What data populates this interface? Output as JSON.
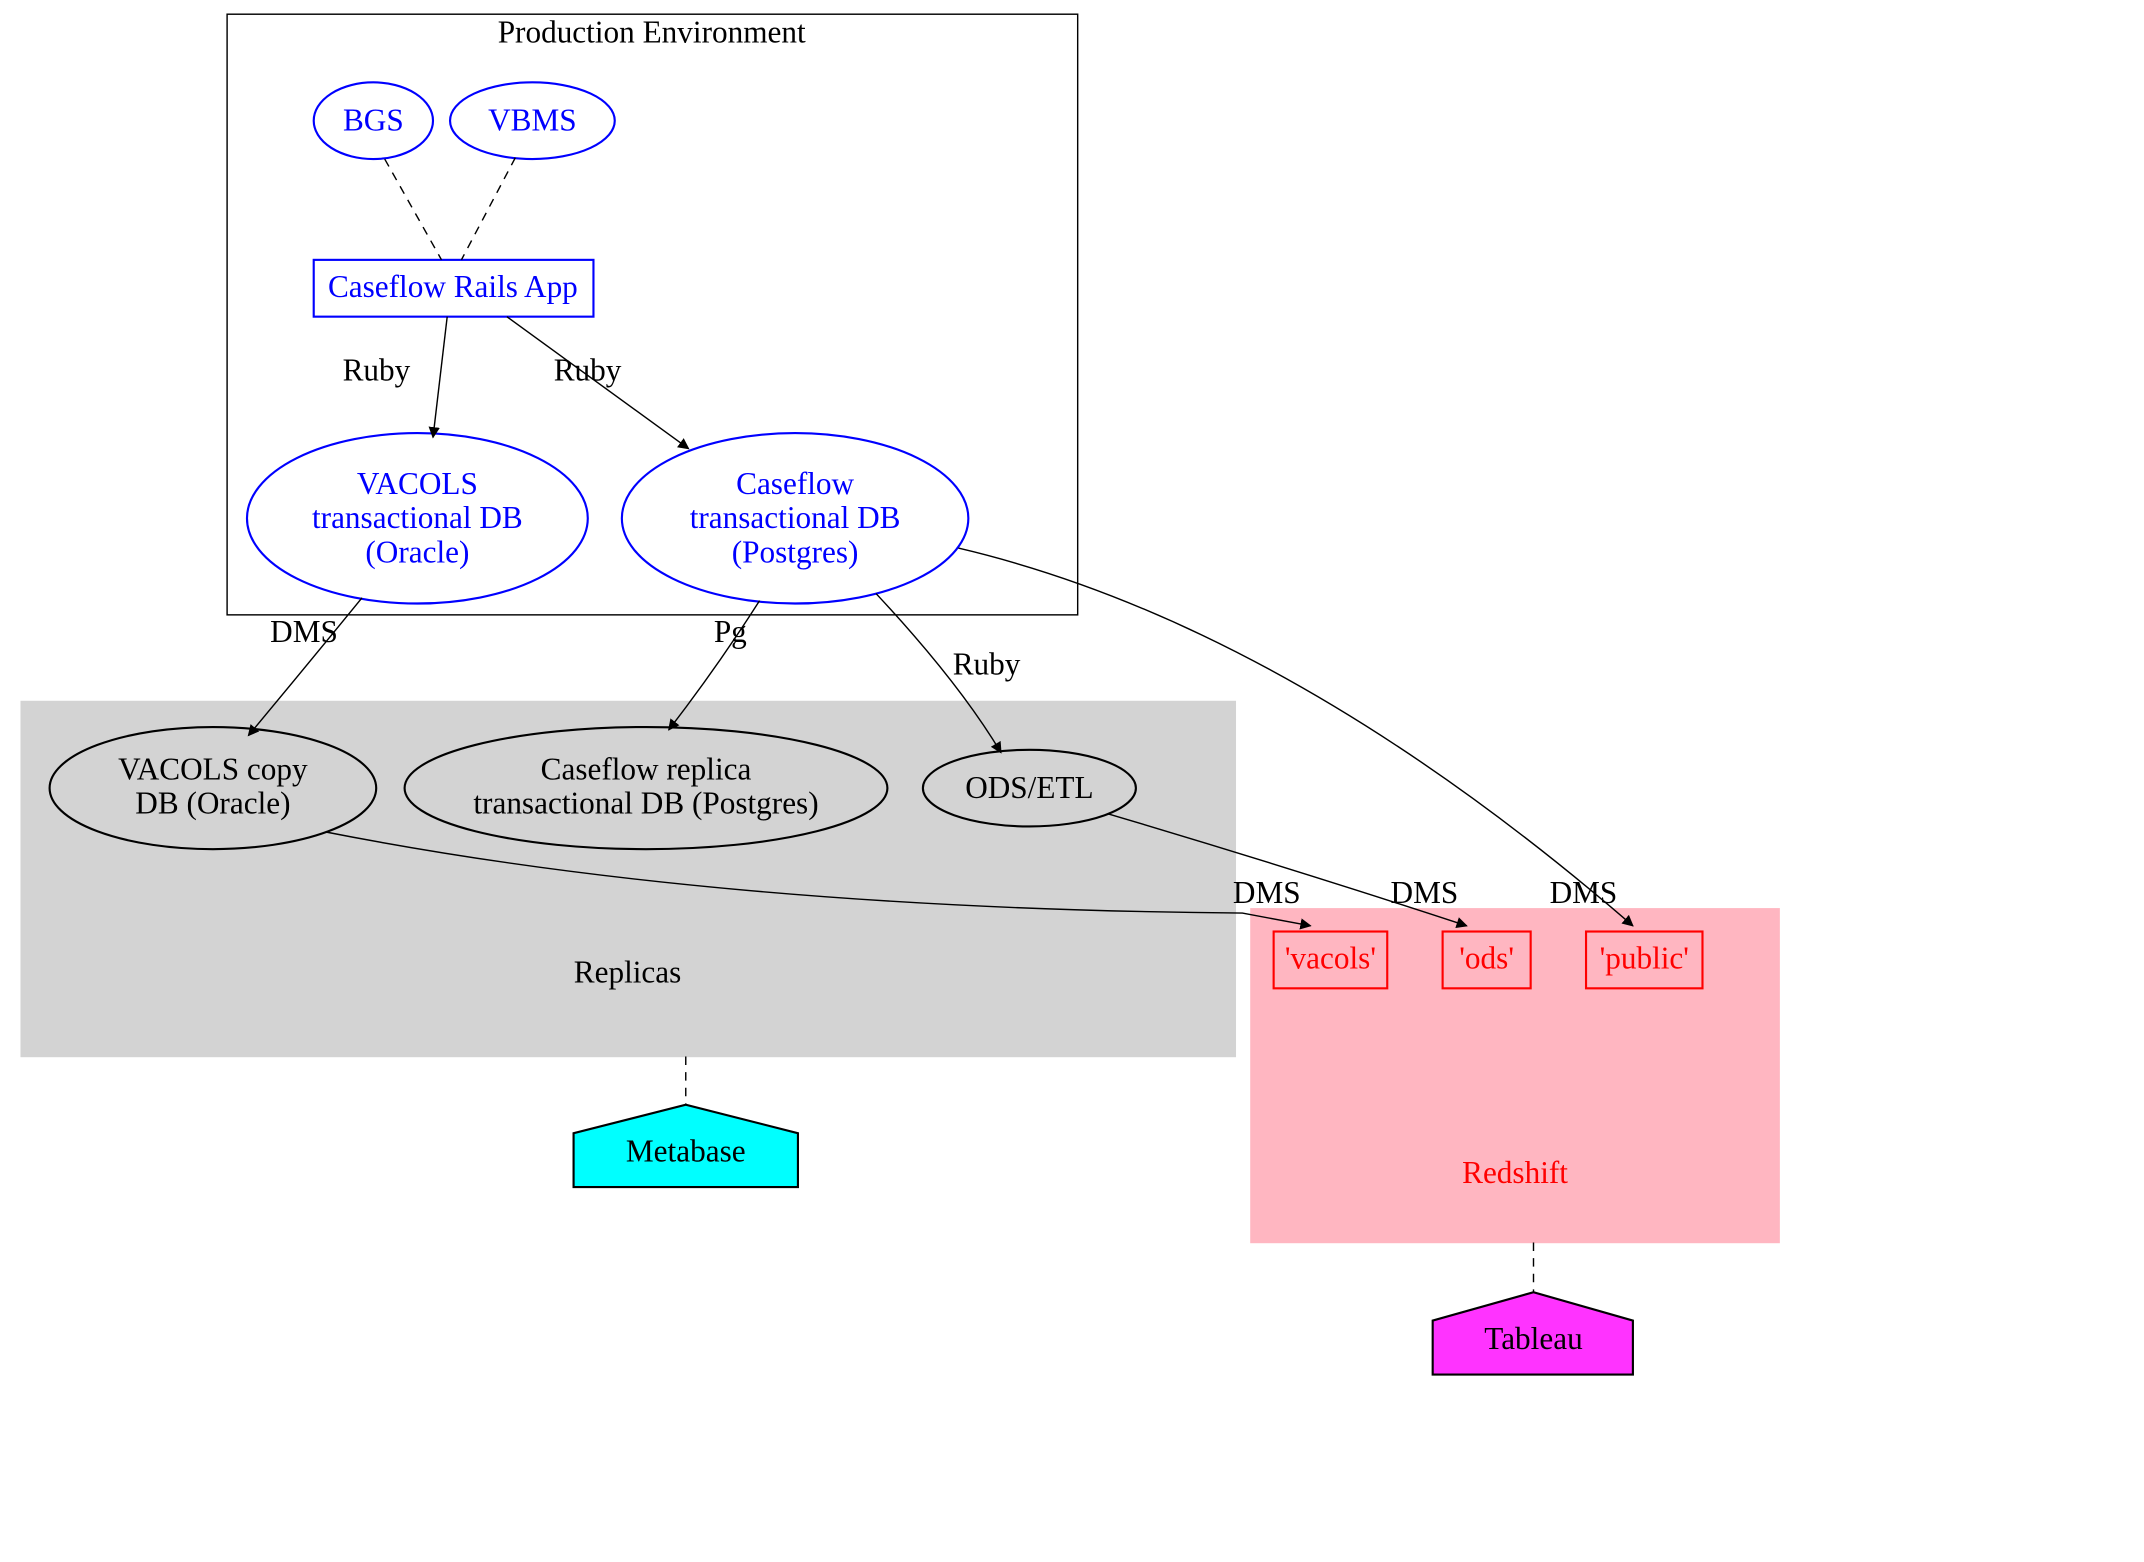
{
  "clusters": {
    "prod": {
      "title": "Production Environment"
    },
    "replicas": {
      "title": "Replicas"
    },
    "redshift": {
      "title": "Redshift"
    }
  },
  "nodes": {
    "bgs": "BGS",
    "vbms": "VBMS",
    "caseflow_app": "Caseflow Rails App",
    "vacols_db_l1": "VACOLS",
    "vacols_db_l2": "transactional DB",
    "vacols_db_l3": "(Oracle)",
    "caseflow_db_l1": "Caseflow",
    "caseflow_db_l2": "transactional DB",
    "caseflow_db_l3": "(Postgres)",
    "vacols_copy_l1": "VACOLS copy",
    "vacols_copy_l2": "DB (Oracle)",
    "caseflow_replica_l1": "Caseflow replica",
    "caseflow_replica_l2": "transactional DB (Postgres)",
    "ods": "ODS/ETL",
    "rs_vacols": "'vacols'",
    "rs_ods": "'ods'",
    "rs_public": "'public'",
    "metabase": "Metabase",
    "tableau": "Tableau"
  },
  "edges": {
    "ruby1": "Ruby",
    "ruby2": "Ruby",
    "dms1": "DMS",
    "pg": "Pg",
    "ruby3": "Ruby",
    "dms_vacols": "DMS",
    "dms_ods": "DMS",
    "dms_public": "DMS"
  }
}
